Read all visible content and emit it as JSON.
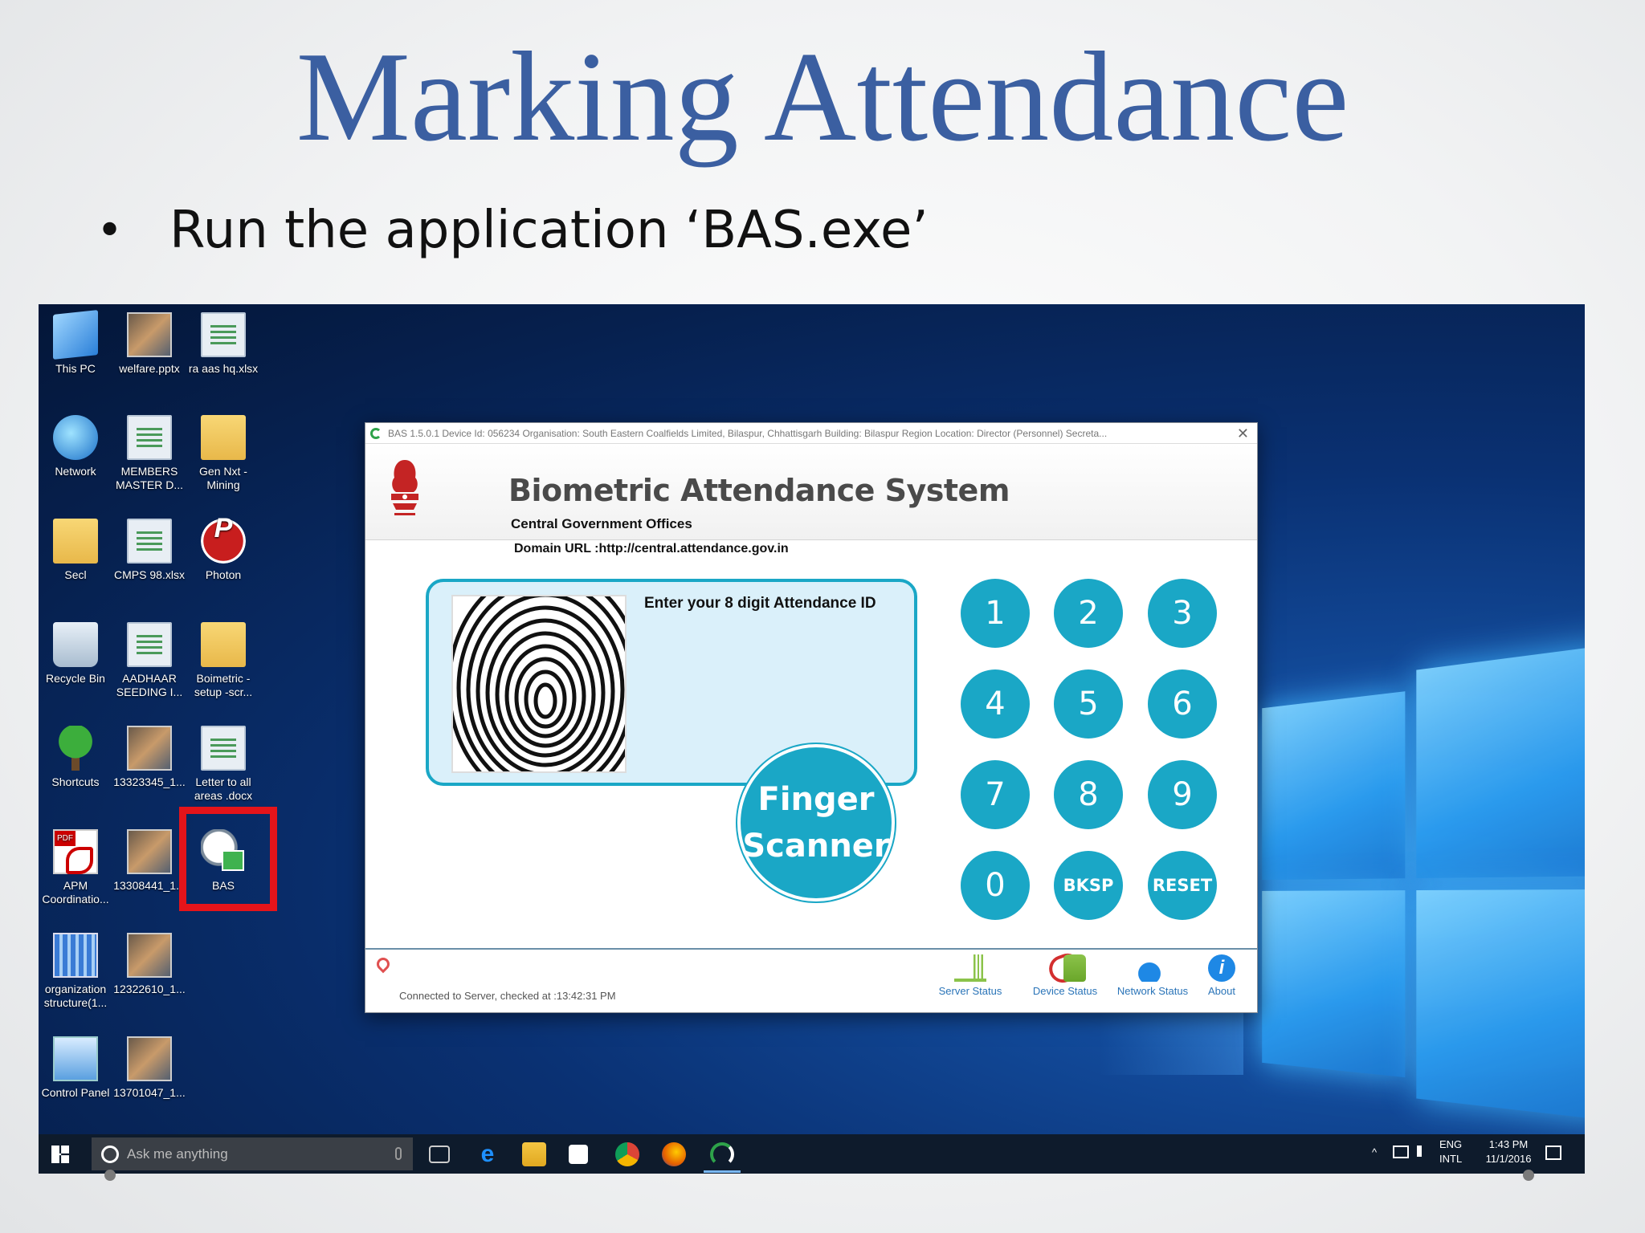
{
  "slide": {
    "title": "Marking Attendance",
    "bullet": "Run the application ‘BAS.exe’"
  },
  "desktop": {
    "icons": [
      {
        "label": "This PC",
        "icon": "pc-icon"
      },
      {
        "label": "welfare.pptx",
        "icon": "image-file-icon"
      },
      {
        "label": "ra aas hq.xlsx",
        "icon": "spreadsheet-icon"
      },
      {
        "label": "Network",
        "icon": "network-icon"
      },
      {
        "label": "MEMBERS MASTER D...",
        "icon": "spreadsheet-icon"
      },
      {
        "label": "Gen Nxt - Mining",
        "icon": "folder-pdf-icon"
      },
      {
        "label": "Secl",
        "icon": "user-folder-icon"
      },
      {
        "label": "CMPS 98.xlsx",
        "icon": "spreadsheet-icon"
      },
      {
        "label": "Photon",
        "icon": "photon-app-icon"
      },
      {
        "label": "Recycle Bin",
        "icon": "recycle-bin-icon"
      },
      {
        "label": "AADHAAR SEEDING I...",
        "icon": "spreadsheet-icon"
      },
      {
        "label": "Boimetric - setup -scr...",
        "icon": "folder-icon"
      },
      {
        "label": "Shortcuts",
        "icon": "tree-icon"
      },
      {
        "label": "13323345_1...",
        "icon": "photo-icon"
      },
      {
        "label": "Letter to all areas .docx",
        "icon": "document-icon"
      },
      {
        "label": "APM Coordinatio...",
        "icon": "pdf-icon"
      },
      {
        "label": "13308441_1...",
        "icon": "photo-icon"
      },
      {
        "label": "BAS",
        "icon": "bas-app-icon"
      },
      {
        "label": "organization structure(1...",
        "icon": "chart-file-icon"
      },
      {
        "label": "12322610_1...",
        "icon": "photo-icon"
      },
      {
        "label": "Control Panel",
        "icon": "control-panel-icon"
      },
      {
        "label": "13701047_1...",
        "icon": "photo-icon"
      }
    ]
  },
  "bas_window": {
    "title_bar": "BAS 1.5.0.1 Device Id: 056234 Organisation: South Eastern Coalfields Limited, Bilaspur, Chhattisgarh Building: Bilaspur Region Location: Director (Personnel) Secreta...",
    "close_glyph": "✕",
    "heading": "Biometric Attendance System",
    "subheading": "Central Government Offices",
    "domain_url": "Domain URL :http://central.attendance.gov.in",
    "prompt": "Enter your 8 digit Attendance ID",
    "attendance_id_value": "",
    "finger_scanner_line1": "Finger",
    "finger_scanner_line2": "Scanner",
    "keys": [
      "1",
      "2",
      "3",
      "4",
      "5",
      "6",
      "7",
      "8",
      "9",
      "0",
      "BKSP",
      "RESET"
    ],
    "connection_status": "Connected to Server, checked at :13:42:31 PM",
    "status_items": {
      "server": "Server Status",
      "device": "Device Status",
      "network": "Network Status",
      "about": "About"
    },
    "about_glyph": "i",
    "colors": {
      "accent": "#1aa7c6",
      "link": "#2a74b8"
    }
  },
  "taskbar": {
    "search_placeholder": "Ask me anything",
    "apps": [
      "task-view-icon",
      "edge-icon",
      "file-explorer-icon",
      "store-icon",
      "chrome-icon",
      "firefox-icon",
      "bas-app-icon"
    ],
    "tray": {
      "chevron": "^",
      "lang_top": "ENG",
      "lang_bottom": "INTL",
      "time": "1:43 PM",
      "date": "11/1/2016"
    }
  }
}
